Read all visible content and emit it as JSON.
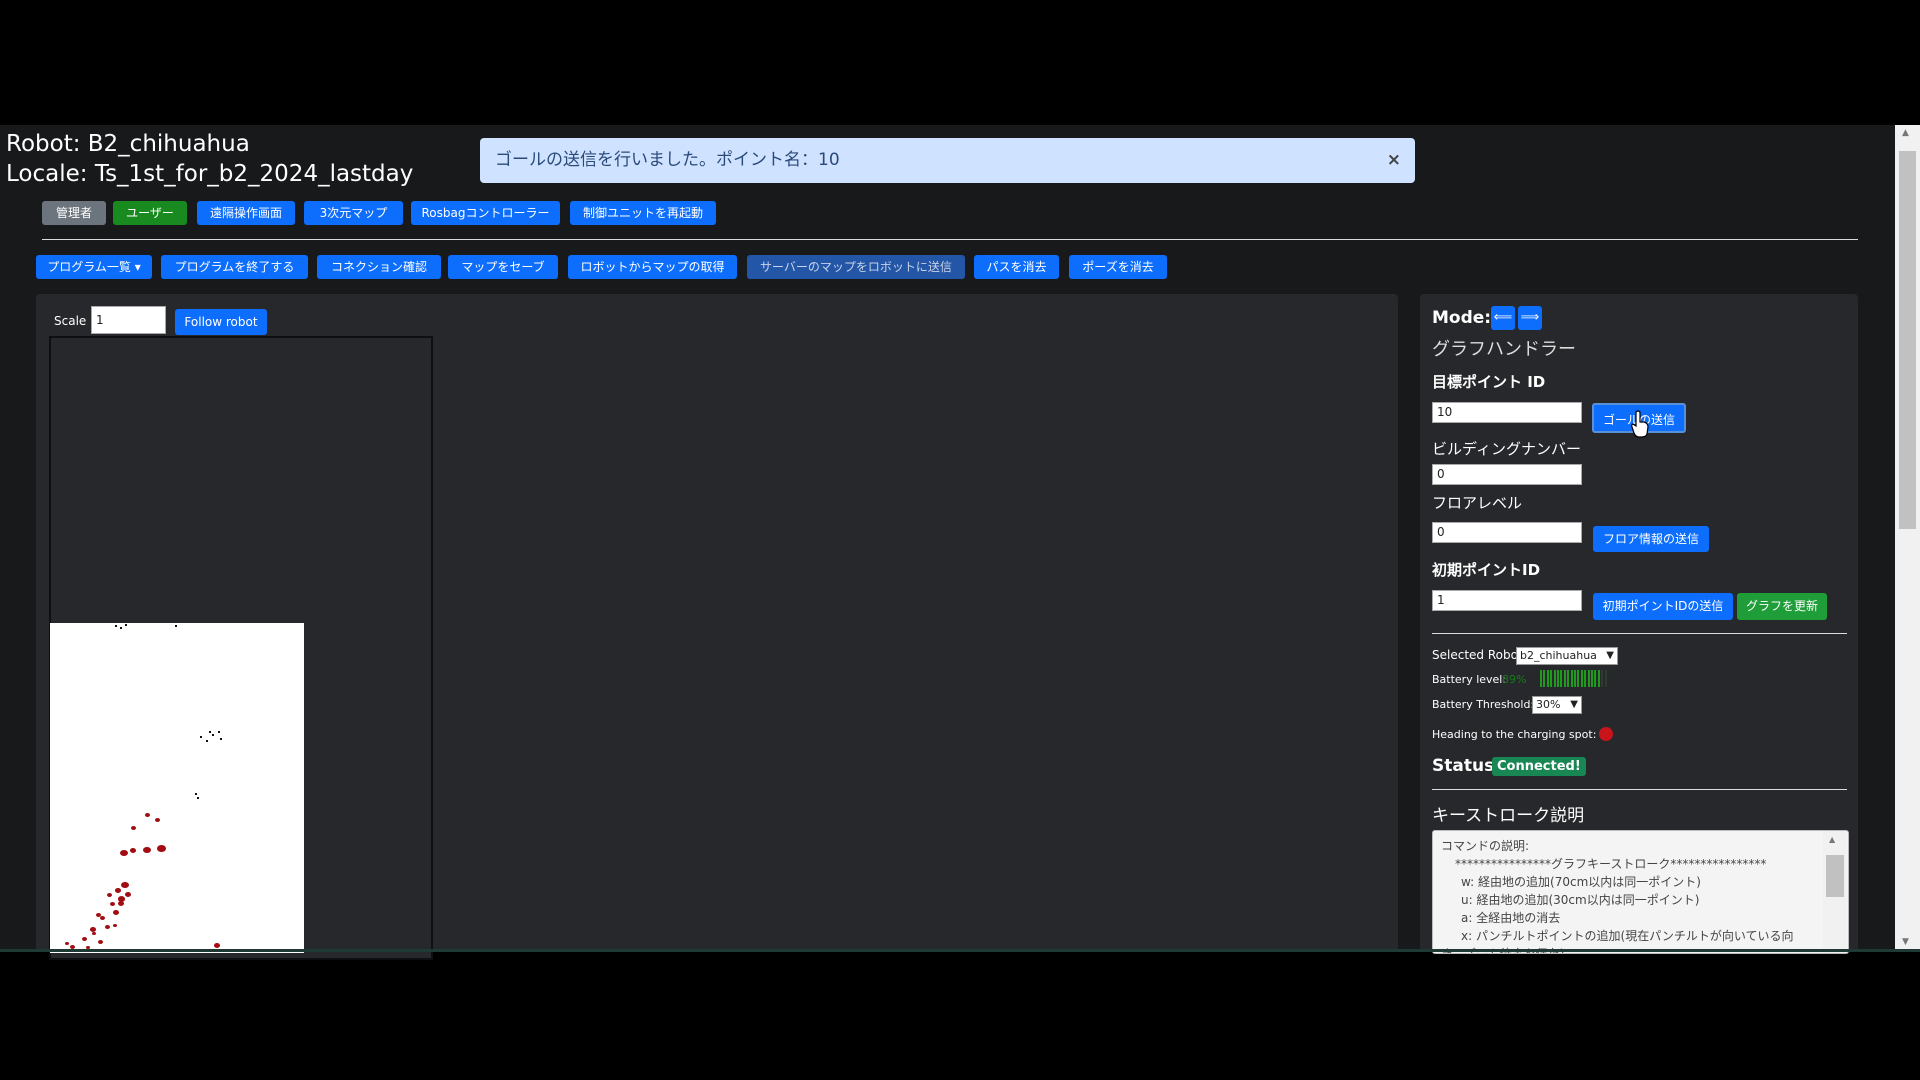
{
  "header": {
    "robot_line": "Robot: B2_chihuahua",
    "locale_line": "Locale: Ts_1st_for_b2_2024_lastday"
  },
  "alert": {
    "message": "ゴールの送信を行いました。ポイント名：10",
    "close": "×"
  },
  "nav_buttons": {
    "admin": "管理者",
    "user": "ユーザー",
    "remote": "遠隔操作画面",
    "map3d": "3次元マップ",
    "rosbag": "Rosbagコントローラー",
    "restart": "制御ユニットを再起動"
  },
  "toolbar": {
    "program_list": "プログラム一覧 ▾",
    "end_program": "プログラムを終了する",
    "check_connection": "コネクション確認",
    "save_map": "マップをセーブ",
    "get_map": "ロボットからマップの取得",
    "send_map": "サーバーのマップをロボットに送信",
    "clear_path": "パスを消去",
    "clear_pose": "ポーズを消去"
  },
  "map": {
    "scale_label": "Scale",
    "scale_value": "1",
    "follow_button": "Follow robot"
  },
  "right_panel": {
    "mode_label": "Mode:",
    "mode_left": "⟸",
    "mode_right": "⟹",
    "handler_name": "グラフハンドラー",
    "goal_id_label": "目標ポイント ID",
    "goal_id_value": "10",
    "send_goal": "ゴールの送信",
    "building_label": "ビルディングナンバー",
    "building_value": "0",
    "floor_label": "フロアレベル",
    "floor_value": "0",
    "send_floor": "フロア情報の送信",
    "init_point_label": "初期ポイントID",
    "init_point_value": "1",
    "send_init_point": "初期ポイントIDの送信",
    "update_graph": "グラフを更新",
    "selected_robot_label": "Selected Robot",
    "selected_robot_value": "b2_chihuahua",
    "battery_level_label": "Battery level:",
    "battery_level_value": "89%",
    "battery_level_fraction": 0.89,
    "battery_threshold_label": "Battery Threshold:",
    "battery_threshold_value": "30%",
    "charging_label": "Heading to the charging spot:",
    "status_label": "Status:",
    "status_value": "Connected!",
    "keystroke_title": "キーストローク説明",
    "keystroke_lines": [
      "コマンドの説明:",
      "****************グラフキーストローク****************",
      "w: 経由地の追加(70cm以内は同一ポイント)",
      "u: 経由地の追加(30cm以内は同一ポイント)",
      "a: 全経由地の消去",
      "x: パンチルトポイントの追加(現在パンチルトが向いている向",
      "き、ズーム倍率を保存)"
    ]
  },
  "colors": {
    "primary": "#0d6efd",
    "success": "#198a1f",
    "alert_bg": "#cfe2ff",
    "panel_bg": "#26282b",
    "page_bg": "#18191b",
    "map_points": "#a10d12"
  }
}
